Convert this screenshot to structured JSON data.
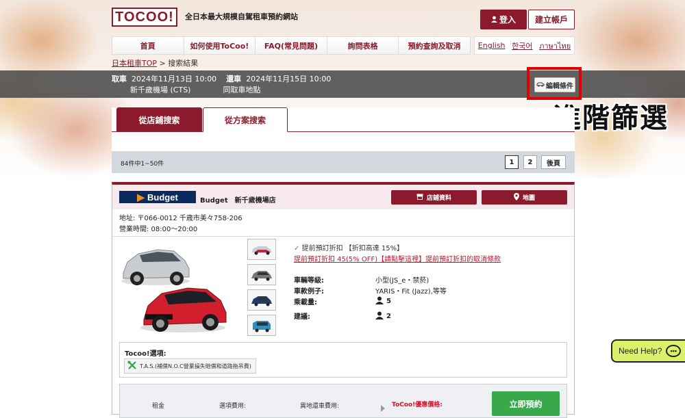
{
  "header": {
    "logo": "TOCOO!",
    "tagline": "全日本最大規模自駕租車預約網站",
    "login": "登入",
    "register": "建立帳戶"
  },
  "nav": {
    "items": [
      "首頁",
      "如何使用ToCoo!",
      "FAQ(常見問題)",
      "詢問表格",
      "預約查詢及取消"
    ],
    "languages": [
      "English",
      "한국어",
      "ภาษาไทย"
    ]
  },
  "breadcrumb": {
    "home": "日本租車TOP",
    "separator": ">",
    "current": "搜索結果"
  },
  "search": {
    "pickup_label": "取車",
    "pickup_datetime": "2024年11月13日 10:00",
    "pickup_place": "新千歲機場 (CTS)",
    "return_label": "還車",
    "return_datetime": "2024年11月15日 10:00",
    "return_place": "同取車地點",
    "edit_button": "編輯條件"
  },
  "annotation": {
    "text": "進階篩選",
    "highlight_color": "#e00000"
  },
  "tabs": [
    {
      "label": "從店鋪搜索",
      "active": false
    },
    {
      "label": "從方案搜索",
      "active": true
    }
  ],
  "pager": {
    "count": "84件中1~50件",
    "pages": [
      "1",
      "2"
    ],
    "current_page": "1",
    "next": "後頁"
  },
  "result": {
    "brand": "Budget",
    "shop_name": "Budget　新千歲機場店",
    "shop_button": "店鋪資料",
    "map_button": "地圖",
    "address": "地址: 〒066-0012 千歳市美々758-206",
    "hours": "營業時間: 08:00〜20:00",
    "promo_title": "提前預訂折扣 【折扣高達 15%】",
    "promo_link": "提前預訂折扣 45(5% OFF)【請點擊這裡】提前預訂折扣的取消條款",
    "specs": [
      {
        "label": "車輛等級:",
        "value": "小型(JS_e・禁菸)"
      },
      {
        "label": "車款例子:",
        "value": "YARIS・Fit (Jazz),等等"
      },
      {
        "label": "乘載量:",
        "value": "5"
      },
      {
        "label": "建議:",
        "value": "2"
      }
    ],
    "options_title": "Tocoo!選項:",
    "option_tag": "T.A.S.(補償N.O.C營業損失賠償和道路拖吊費)",
    "price_labels": [
      "租金",
      "選項費用:",
      "異地還車費用:"
    ],
    "tocoo_price_label": "ToCoo!優惠價格:",
    "reserve_button": "立即預約"
  },
  "help": {
    "label": "Need Help?"
  },
  "colors": {
    "brand": "#8a1a2c",
    "accent_green": "#38a84a",
    "help_bg": "#d9f26a",
    "promo_red": "#c0152f"
  }
}
